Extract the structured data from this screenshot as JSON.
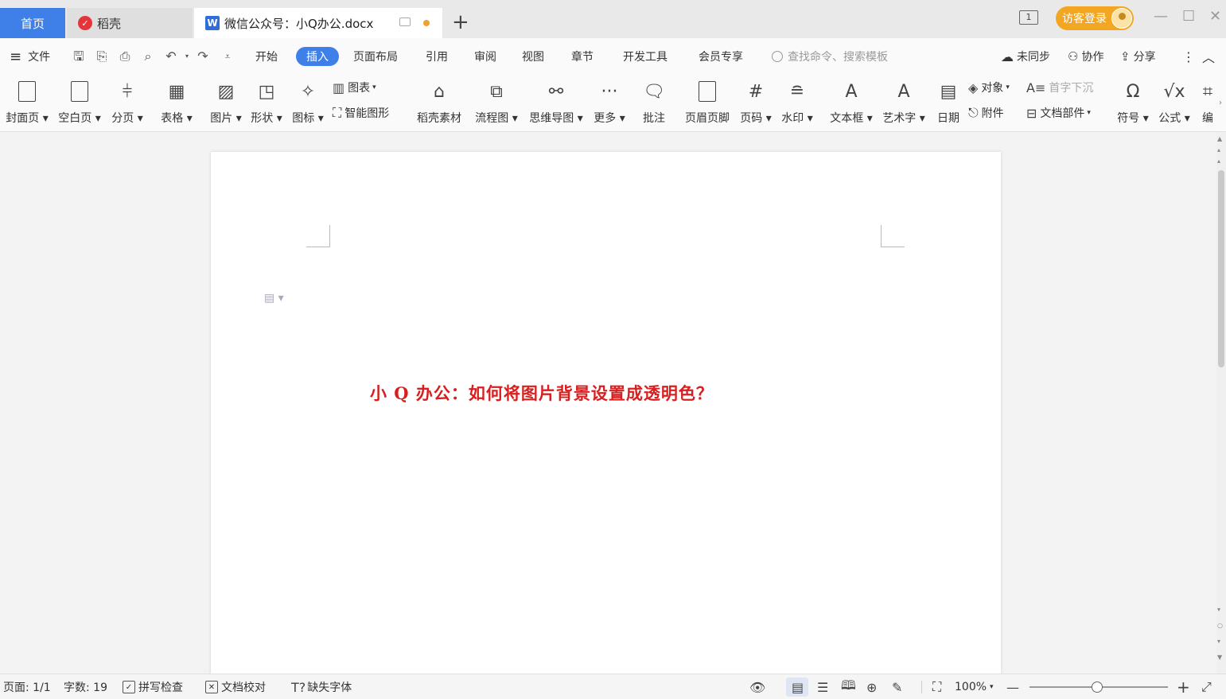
{
  "tabs": {
    "home": "首页",
    "daoke": "稻壳",
    "doc_title": "微信公众号：小Q办公.docx"
  },
  "titlebar": {
    "pageview_number": "1",
    "login_label": "访客登录"
  },
  "menu": {
    "file": "文件",
    "items": [
      "开始",
      "插入",
      "页面布局",
      "引用",
      "审阅",
      "视图",
      "章节",
      "开发工具",
      "会员专享"
    ],
    "active": "插入",
    "search_placeholder": "查找命令、搜索模板",
    "sync": "未同步",
    "collab": "协作",
    "share": "分享"
  },
  "ribbon": {
    "cover": "封面页",
    "blank": "空白页",
    "pagebreak": "分页",
    "table": "表格",
    "picture": "图片",
    "shape": "形状",
    "icon": "图标",
    "chart": "图表",
    "smartart": "智能图形",
    "daoke_material": "稻壳素材",
    "flowchart": "流程图",
    "mindmap": "思维导图",
    "more": "更多",
    "comment": "批注",
    "header_footer": "页眉页脚",
    "page_number": "页码",
    "watermark": "水印",
    "textbox": "文本框",
    "wordart": "艺术字",
    "date": "日期",
    "object": "对象",
    "dropcap": "首字下沉",
    "attachment": "附件",
    "doc_parts": "文档部件",
    "symbol": "符号",
    "formula": "公式",
    "edit": "编"
  },
  "document": {
    "title_text": "小 Q 办公：如何将图片背景设置成透明色？",
    "title_color": "#d81e1e"
  },
  "status": {
    "page": "页面: 1/1",
    "word_count": "字数: 19",
    "spellcheck": "拼写检查",
    "proofread": "文档校对",
    "missing_font": "缺失字体",
    "zoom": "100%"
  },
  "colors": {
    "accent": "#3f7fe8",
    "login": "#f3a621"
  }
}
